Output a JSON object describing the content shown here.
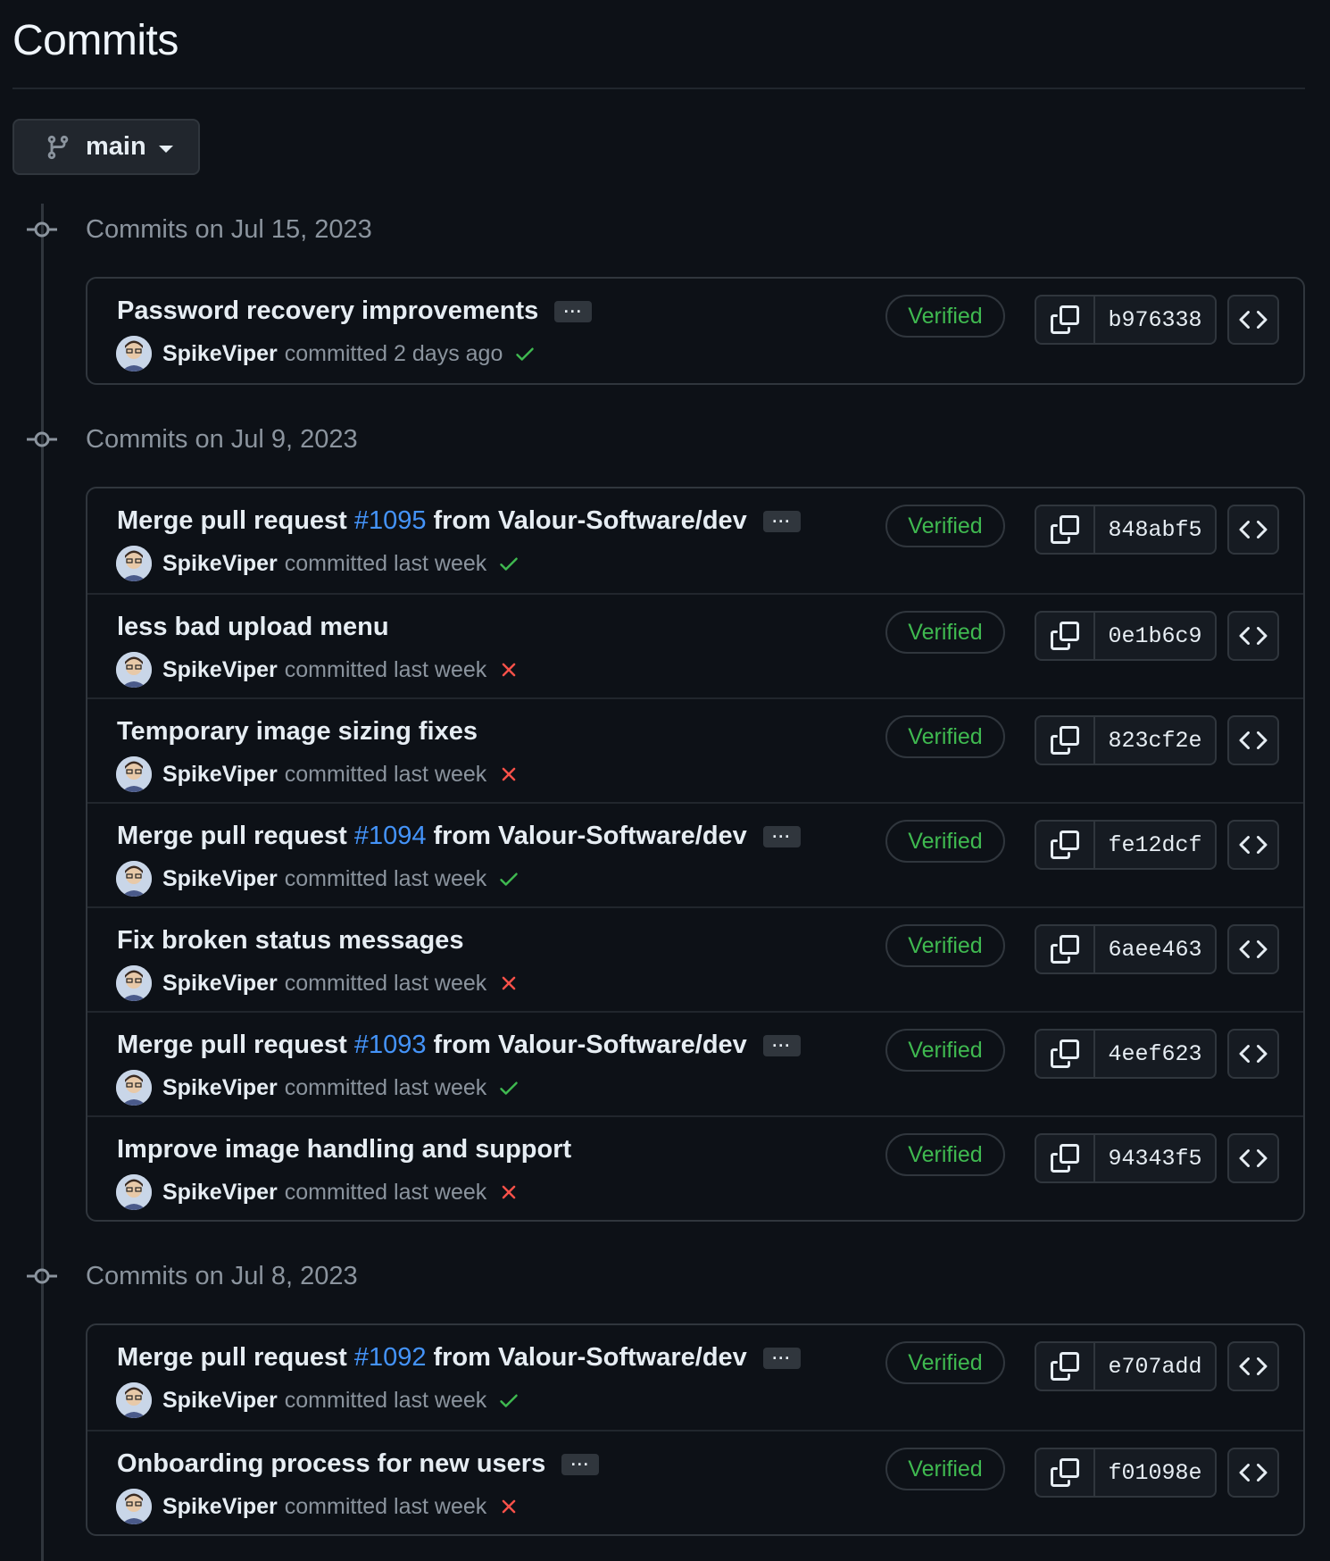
{
  "page": {
    "title": "Commits"
  },
  "branch": {
    "name": "main",
    "icon": "git-branch-icon"
  },
  "colors": {
    "verified": "#3fb950",
    "link": "#4493f8",
    "success": "#3fb950",
    "failure": "#f85149"
  },
  "groups": [
    {
      "date_label": "Commits on Jul 15, 2023",
      "commits": [
        {
          "title_before": "Password recovery improvements",
          "pr": "",
          "title_after": "",
          "has_ellipsis": true,
          "author": "SpikeViper",
          "time": "committed 2 days ago",
          "status": "success",
          "verified": "Verified",
          "sha": "b976338"
        }
      ]
    },
    {
      "date_label": "Commits on Jul 9, 2023",
      "commits": [
        {
          "title_before": "Merge pull request",
          "pr": "#1095",
          "title_after": "from Valour-Software/dev",
          "has_ellipsis": true,
          "author": "SpikeViper",
          "time": "committed last week",
          "status": "success",
          "verified": "Verified",
          "sha": "848abf5"
        },
        {
          "title_before": "less bad upload menu",
          "pr": "",
          "title_after": "",
          "has_ellipsis": false,
          "author": "SpikeViper",
          "time": "committed last week",
          "status": "failure",
          "verified": "Verified",
          "sha": "0e1b6c9"
        },
        {
          "title_before": "Temporary image sizing fixes",
          "pr": "",
          "title_after": "",
          "has_ellipsis": false,
          "author": "SpikeViper",
          "time": "committed last week",
          "status": "failure",
          "verified": "Verified",
          "sha": "823cf2e"
        },
        {
          "title_before": "Merge pull request",
          "pr": "#1094",
          "title_after": "from Valour-Software/dev",
          "has_ellipsis": true,
          "author": "SpikeViper",
          "time": "committed last week",
          "status": "success",
          "verified": "Verified",
          "sha": "fe12dcf"
        },
        {
          "title_before": "Fix broken status messages",
          "pr": "",
          "title_after": "",
          "has_ellipsis": false,
          "author": "SpikeViper",
          "time": "committed last week",
          "status": "failure",
          "verified": "Verified",
          "sha": "6aee463"
        },
        {
          "title_before": "Merge pull request",
          "pr": "#1093",
          "title_after": "from Valour-Software/dev",
          "has_ellipsis": true,
          "author": "SpikeViper",
          "time": "committed last week",
          "status": "success",
          "verified": "Verified",
          "sha": "4eef623"
        },
        {
          "title_before": "Improve image handling and support",
          "pr": "",
          "title_after": "",
          "has_ellipsis": false,
          "author": "SpikeViper",
          "time": "committed last week",
          "status": "failure",
          "verified": "Verified",
          "sha": "94343f5"
        }
      ]
    },
    {
      "date_label": "Commits on Jul 8, 2023",
      "commits": [
        {
          "title_before": "Merge pull request",
          "pr": "#1092",
          "title_after": "from Valour-Software/dev",
          "has_ellipsis": true,
          "author": "SpikeViper",
          "time": "committed last week",
          "status": "success",
          "verified": "Verified",
          "sha": "e707add"
        },
        {
          "title_before": "Onboarding process for new users",
          "pr": "",
          "title_after": "",
          "has_ellipsis": true,
          "author": "SpikeViper",
          "time": "committed last week",
          "status": "failure",
          "verified": "Verified",
          "sha": "f01098e"
        }
      ]
    }
  ],
  "ellipsis_label": "···"
}
